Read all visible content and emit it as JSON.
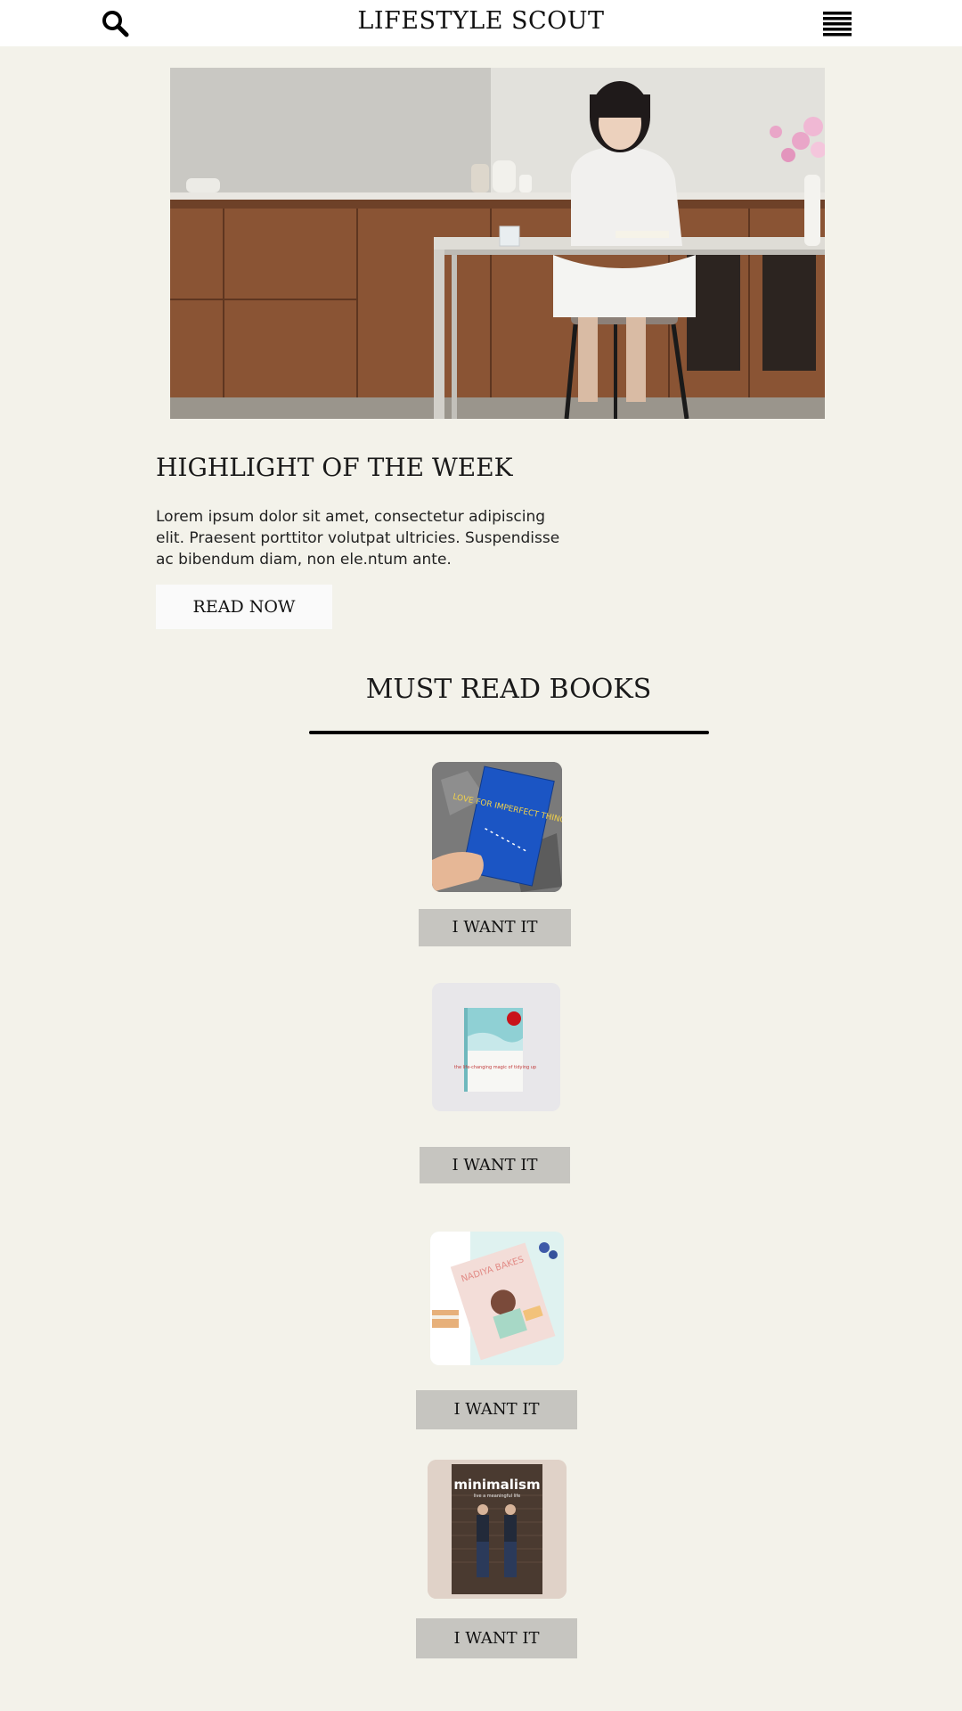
{
  "header": {
    "title": "LIFESTYLE SCOUT",
    "search_icon": "search-icon",
    "menu_icon": "hamburger-menu-icon"
  },
  "highlight": {
    "heading": "HIGHLIGHT OF THE WEEK",
    "body": "Lorem ipsum dolor sit amet, consectetur adipiscing elit. Praesent porttitor volutpat ultricies. Suspendisse ac bibendum diam, non ele.ntum ante.",
    "cta_label": "READ NOW"
  },
  "books": {
    "heading": "MUST READ BOOKS",
    "items": [
      {
        "cover_title": "LOVE FOR IMPERFECT THINGS",
        "button_label": "I WANT IT"
      },
      {
        "cover_title": "the life-changing magic of tidying up",
        "button_label": "I WANT IT"
      },
      {
        "cover_title": "NADIYA BAKES",
        "button_label": "I WANT IT"
      },
      {
        "cover_title": "minimalism",
        "cover_subtitle": "live a meaningful life",
        "button_label": "I WANT IT"
      }
    ]
  },
  "colors": {
    "page_background": "#f3f2ea",
    "header_background": "#ffffff",
    "button_grey": "#c6c5c0",
    "cta_background": "#fafafa"
  }
}
